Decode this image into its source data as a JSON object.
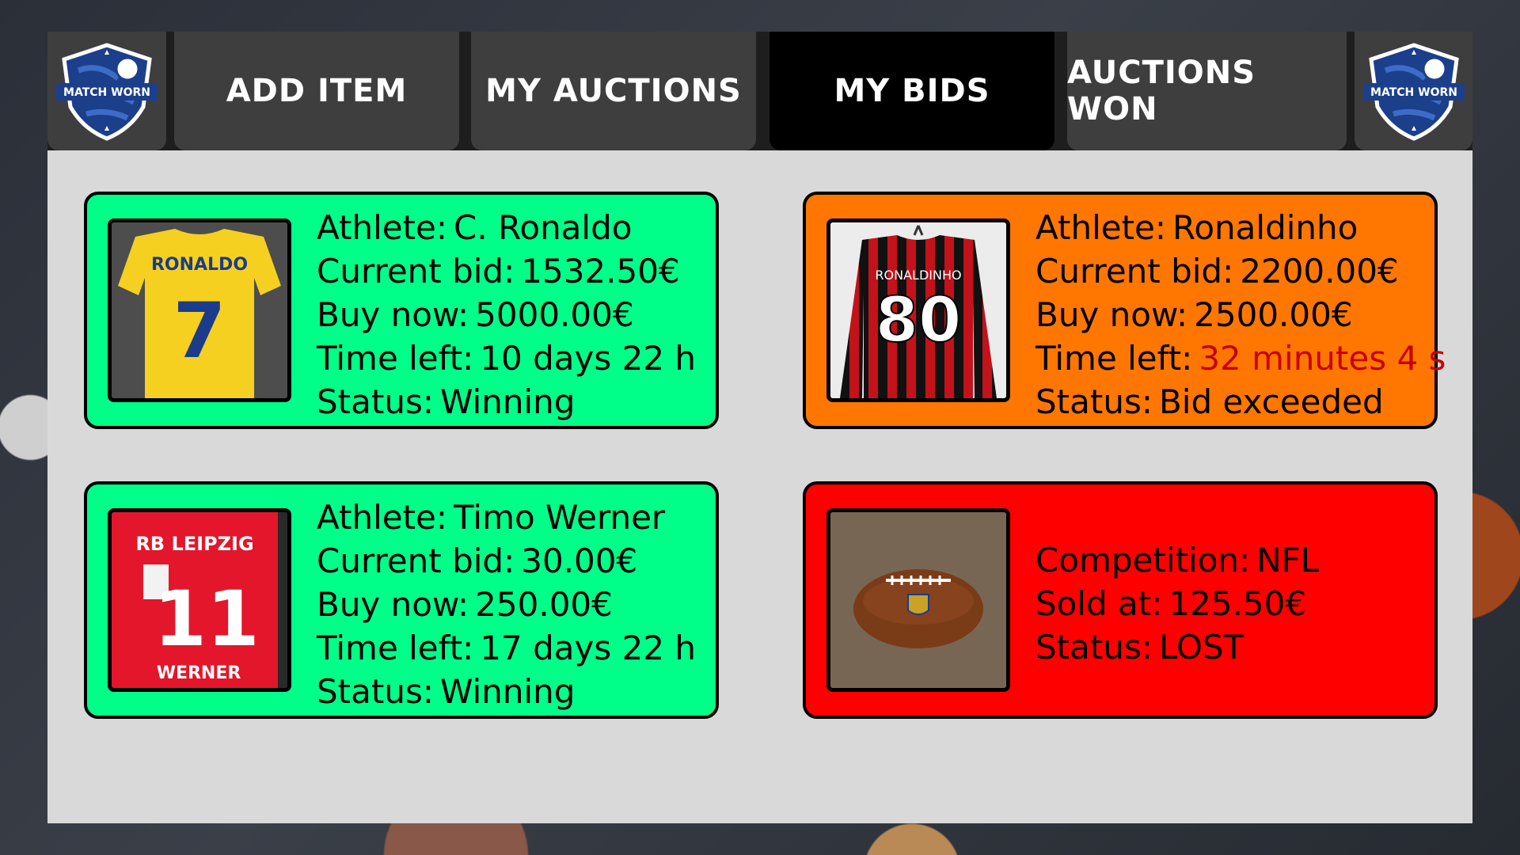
{
  "nav": {
    "logo_text": "MATCH WORN",
    "tabs": [
      {
        "label": "ADD ITEM"
      },
      {
        "label": "MY AUCTIONS"
      },
      {
        "label": "MY BIDS"
      },
      {
        "label": "AUCTIONS WON"
      }
    ],
    "active_tab": "MY BIDS"
  },
  "colors": {
    "winning": "#00ff88",
    "exceeded": "#ff7700",
    "lost": "#ff0000",
    "urgent_time": "#c80000"
  },
  "bids": [
    {
      "status_key": "winning",
      "photo_icon": "yellow-jersey-ronaldo-7",
      "jersey_name": "RONALDO",
      "jersey_number": "7",
      "rows": [
        {
          "label": "Athlete:",
          "value": "C. Ronaldo"
        },
        {
          "label": "Current bid:",
          "value": "1532.50€"
        },
        {
          "label": "Buy now:",
          "value": "5000.00€"
        },
        {
          "label": "Time left:",
          "value": "10 days 22 h"
        },
        {
          "label": "Status:",
          "value": "Winning"
        }
      ]
    },
    {
      "status_key": "exceeded",
      "photo_icon": "milan-jersey-ronaldinho-80",
      "jersey_name": "RONALDINHO",
      "jersey_number": "80",
      "rows": [
        {
          "label": "Athlete:",
          "value": "Ronaldinho"
        },
        {
          "label": "Current bid:",
          "value": "2200.00€"
        },
        {
          "label": "Buy now:",
          "value": "2500.00€"
        },
        {
          "label": "Time left:",
          "value": "32 minutes 4 s"
        },
        {
          "label": "Status:",
          "value": "Bid exceeded"
        }
      ]
    },
    {
      "status_key": "winning",
      "photo_icon": "leipzig-jersey-werner-11",
      "jersey_club": "RB LEIPZIG",
      "jersey_name": "WERNER",
      "jersey_number": "11",
      "rows": [
        {
          "label": "Athlete:",
          "value": "Timo Werner"
        },
        {
          "label": "Current bid:",
          "value": "30.00€"
        },
        {
          "label": "Buy now:",
          "value": "250.00€"
        },
        {
          "label": "Time left:",
          "value": "17 days 22 h"
        },
        {
          "label": "Status:",
          "value": "Winning"
        }
      ]
    },
    {
      "status_key": "lost",
      "photo_icon": "nfl-football",
      "rows": [
        {
          "label": "Competition:",
          "value": "NFL"
        },
        {
          "label": "Sold at:",
          "value": "125.50€"
        },
        {
          "label": "Status:",
          "value": "LOST"
        }
      ]
    }
  ]
}
